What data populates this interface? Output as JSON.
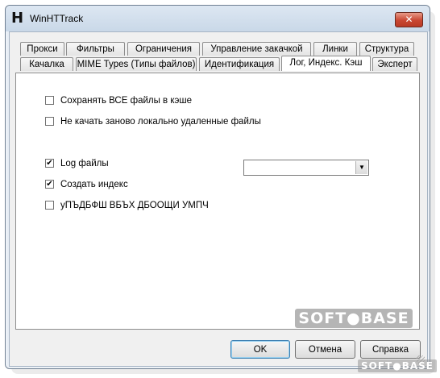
{
  "window": {
    "title": "WinHTTrack",
    "app_icon_glyph": "H",
    "close_glyph": "✕"
  },
  "tabs": {
    "row1": [
      "Прокси",
      "Фильтры",
      "Ограничения",
      "Управление закачкой",
      "Линки",
      "Структура"
    ],
    "row2": [
      "Качалка",
      "MIME Types (Типы файлов)",
      "Идентификация",
      "Лог, Индекс. Кэш",
      "Эксперт"
    ],
    "active": "Лог, Индекс. Кэш"
  },
  "options": [
    {
      "label": "Сохранять ВСЕ файлы в кэше",
      "checked": false
    },
    {
      "label": "Не качать заново локально удаленные файлы",
      "checked": false
    },
    {
      "label": "Log файлы",
      "checked": true
    },
    {
      "label": "Создать индекс",
      "checked": true
    },
    {
      "label": "уПЪДБФШ ВБЪХ ДБООЩИ УМПЧ",
      "checked": false
    }
  ],
  "log_combo": {
    "value": "",
    "arrow_icon": "dropdown-arrow-icon"
  },
  "buttons": {
    "ok": "OK",
    "cancel": "Отмена",
    "help": "Справка"
  },
  "watermark": {
    "main": "SOFT●BASE",
    "small": "SOFT●BASE"
  },
  "check_glyph": "✔"
}
